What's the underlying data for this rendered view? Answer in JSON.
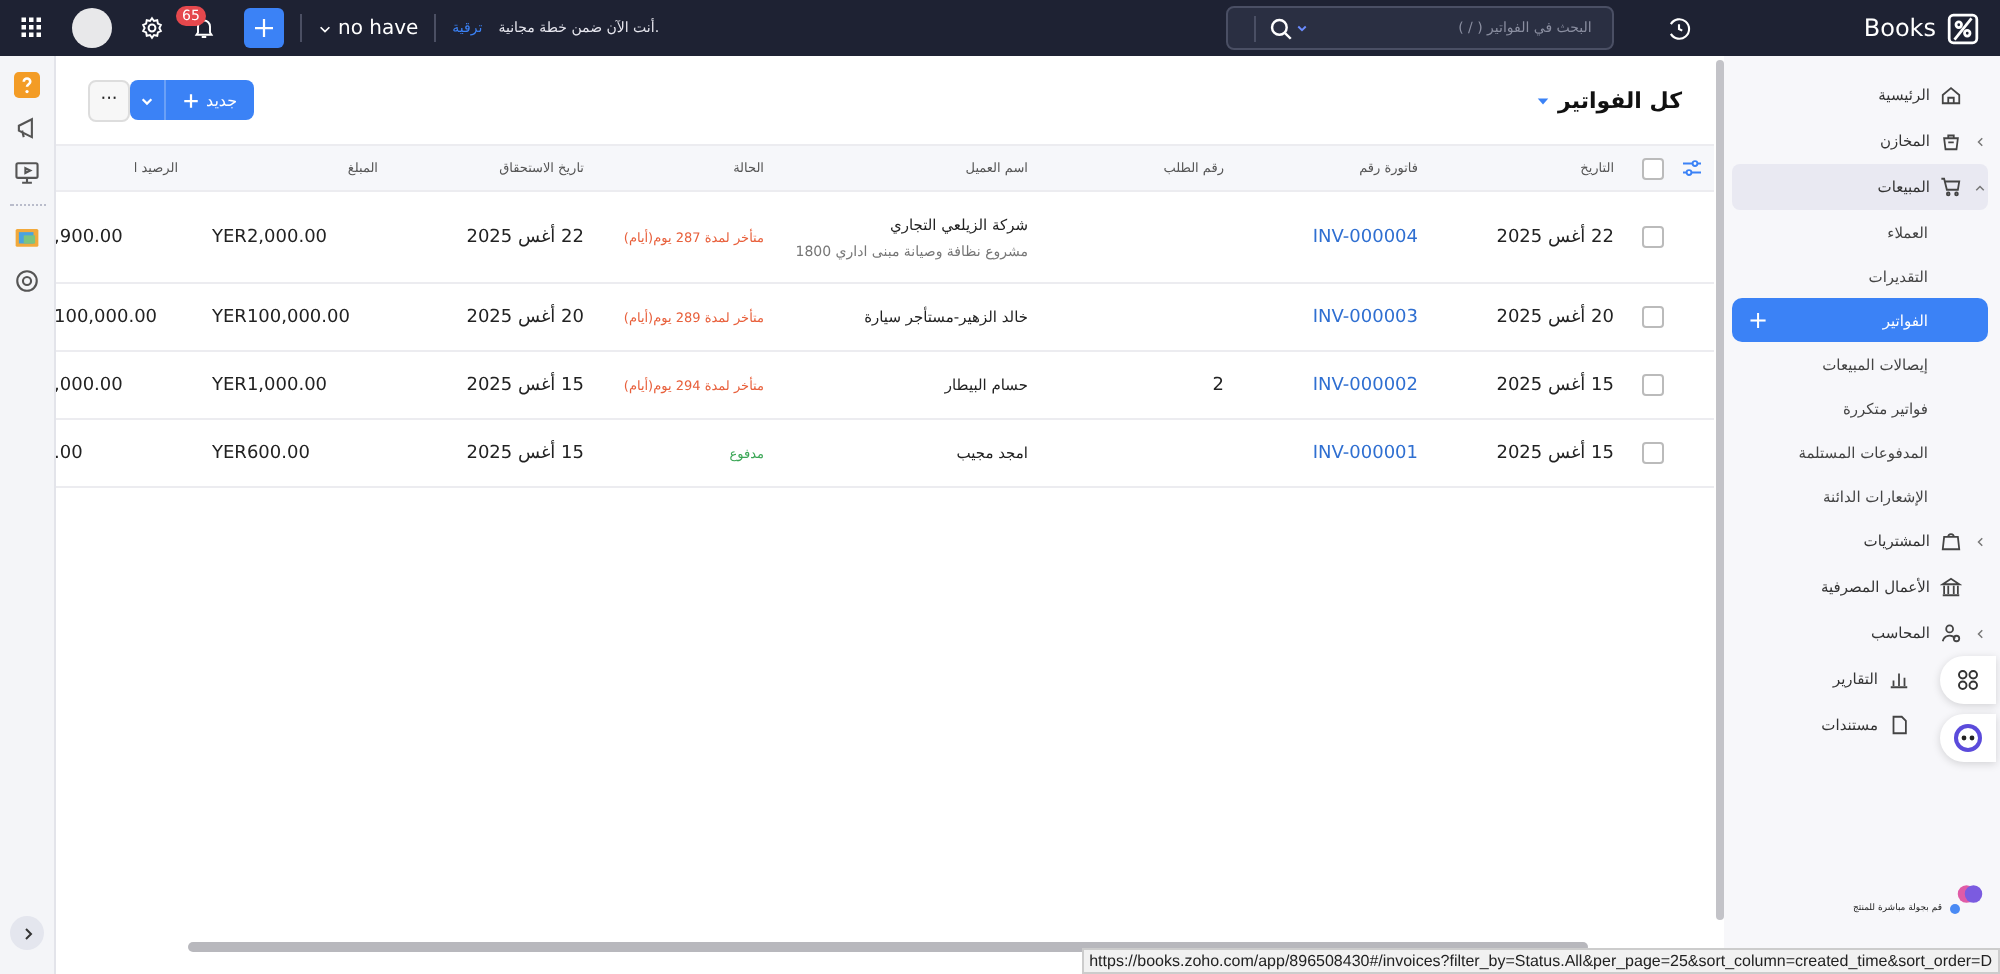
{
  "topbar": {
    "badge_count": "65",
    "org": "no have",
    "upgrade_link": "ترقية",
    "plan_notice": "أنت الآن ضمن خطة مجانية.",
    "search": {
      "placeholder": "البحث في الفواتير ( / )"
    },
    "logo": "Books"
  },
  "page": {
    "title": "كل الفواتير",
    "new_button": "جديد",
    "more_button": "···"
  },
  "table": {
    "header_checked": false,
    "columns": [
      "التاريخ",
      "فاتورة رقم",
      "رقم الطلب",
      "اسم العميل",
      "الحالة",
      "تاريخ الاستحقاق",
      "المبلغ",
      "الرصيد ا"
    ],
    "rows": [
      {
        "checked": false,
        "date": "22 أغس 2025",
        "invoice": "INV-000004",
        "order": "",
        "customer": "شركة الزيلعي التجاري",
        "note": "مشروع نظافة وصيانة مبنى اداري 1800",
        "status": {
          "kind": "overdue",
          "text": "متأخر لمدة 287 يوم(أيام)"
        },
        "due": "22 أغس 2025",
        "amount": "YER2,000.00",
        "balance": ",900.00"
      },
      {
        "checked": false,
        "date": "20 أغس 2025",
        "invoice": "INV-000003",
        "order": "",
        "customer": "خالد الزهير-مستأجر سيارة",
        "status": {
          "kind": "overdue",
          "text": "متأخر لمدة 289 يوم(أيام)"
        },
        "due": "20 أغس 2025",
        "amount": "YER100,000.00",
        "balance": "100,000.00"
      },
      {
        "checked": false,
        "date": "15 أغس 2025",
        "invoice": "INV-000002",
        "order": "2",
        "customer": "حسام البيطار",
        "status": {
          "kind": "overdue",
          "text": "متأخر لمدة 294 يوم(أيام)"
        },
        "due": "15 أغس 2025",
        "amount": "YER1,000.00",
        "balance": ",000.00"
      },
      {
        "checked": false,
        "date": "15 أغس 2025",
        "invoice": "INV-000001",
        "order": "",
        "customer": "امجد مجيب",
        "status": {
          "kind": "paid",
          "text": "مدفوع"
        },
        "due": "15 أغس 2025",
        "amount": "YER600.00",
        "balance": ".00"
      }
    ]
  },
  "sidebar": {
    "items": [
      {
        "label": "الرئيسية",
        "kind": "link",
        "selected": false
      },
      {
        "label": "المخازن",
        "kind": "group",
        "expanded": false,
        "selected": false
      },
      {
        "label": "المبيعات",
        "kind": "group",
        "expanded": true,
        "selected": false,
        "children": [
          {
            "label": "العملاء",
            "selected": false
          },
          {
            "label": "التقديرات",
            "selected": false
          },
          {
            "label": "الفواتير",
            "selected": true,
            "add": "+"
          },
          {
            "label": "إيصالات المبيعات",
            "selected": false
          },
          {
            "label": "فواتير متكررة",
            "selected": false
          },
          {
            "label": "المدفوعات المستلمة",
            "selected": false
          },
          {
            "label": "الإشعارات الدائنة",
            "selected": false
          }
        ]
      },
      {
        "label": "المشتريات",
        "kind": "group",
        "expanded": false,
        "selected": false
      },
      {
        "label": "الأعمال المصرفية",
        "kind": "link",
        "selected": false
      },
      {
        "label": "المحاسب",
        "kind": "group",
        "expanded": false,
        "selected": false
      },
      {
        "label": "التقارير",
        "kind": "link",
        "selected": false
      },
      {
        "label": "مستندات",
        "kind": "link",
        "selected": false
      }
    ],
    "tour_text": "قم بجولة مباشرة للمنتج"
  },
  "status_url": "https://books.zoho.com/app/896508430#/invoices?filter_by=Status.All&per_page=25&sort_column=created_time&sort_order=D"
}
